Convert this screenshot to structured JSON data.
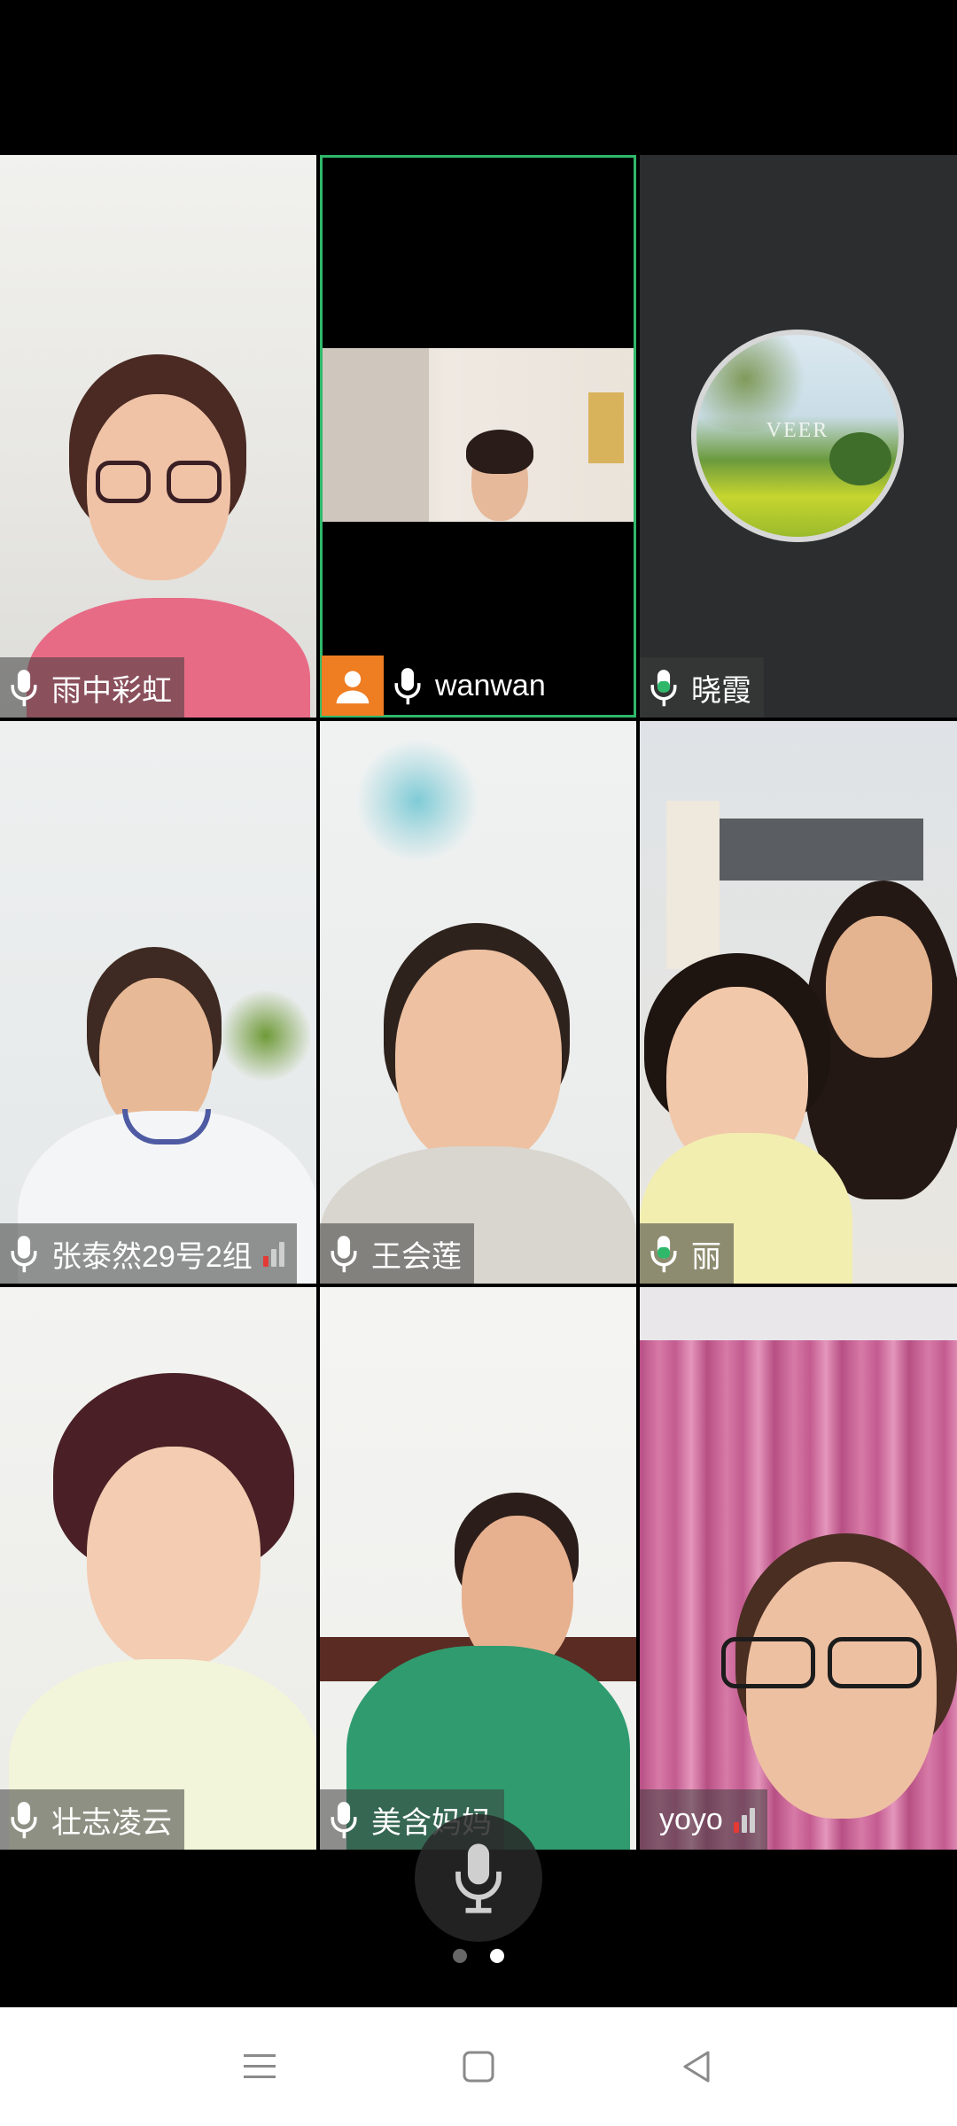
{
  "participants": [
    {
      "name": "雨中彩虹",
      "mic_state": "active",
      "signal": false
    },
    {
      "name": "wanwan",
      "mic_state": "active",
      "signal": false,
      "active_speaker": true,
      "avatar_badge": true
    },
    {
      "name": "晓霞",
      "mic_state": "speaking",
      "signal": false,
      "profile_picture_text": "VEER"
    },
    {
      "name": "张泰然29号2组",
      "mic_state": "active",
      "signal": true
    },
    {
      "name": "王会莲",
      "mic_state": "active",
      "signal": false
    },
    {
      "name": "丽",
      "mic_state": "speaking",
      "signal": false
    },
    {
      "name": "壮志凌云",
      "mic_state": "active",
      "signal": false
    },
    {
      "name": "美含妈妈",
      "mic_state": "active",
      "signal": false
    },
    {
      "name": "yoyo",
      "mic_state": "none",
      "signal": true
    }
  ],
  "colors": {
    "speaking_green": "#2fb86a",
    "active_speaker_border": "#2fb86a",
    "avatar_badge": "#ef7d22",
    "signal_red": "#e53935",
    "signal_gray": "#cfcfcf"
  },
  "controls": {
    "mic_button": "microphone-icon",
    "pages": {
      "total": 2,
      "current": 2
    }
  },
  "nav": {
    "menu": "menu-icon",
    "home": "home-icon",
    "back": "back-icon"
  }
}
